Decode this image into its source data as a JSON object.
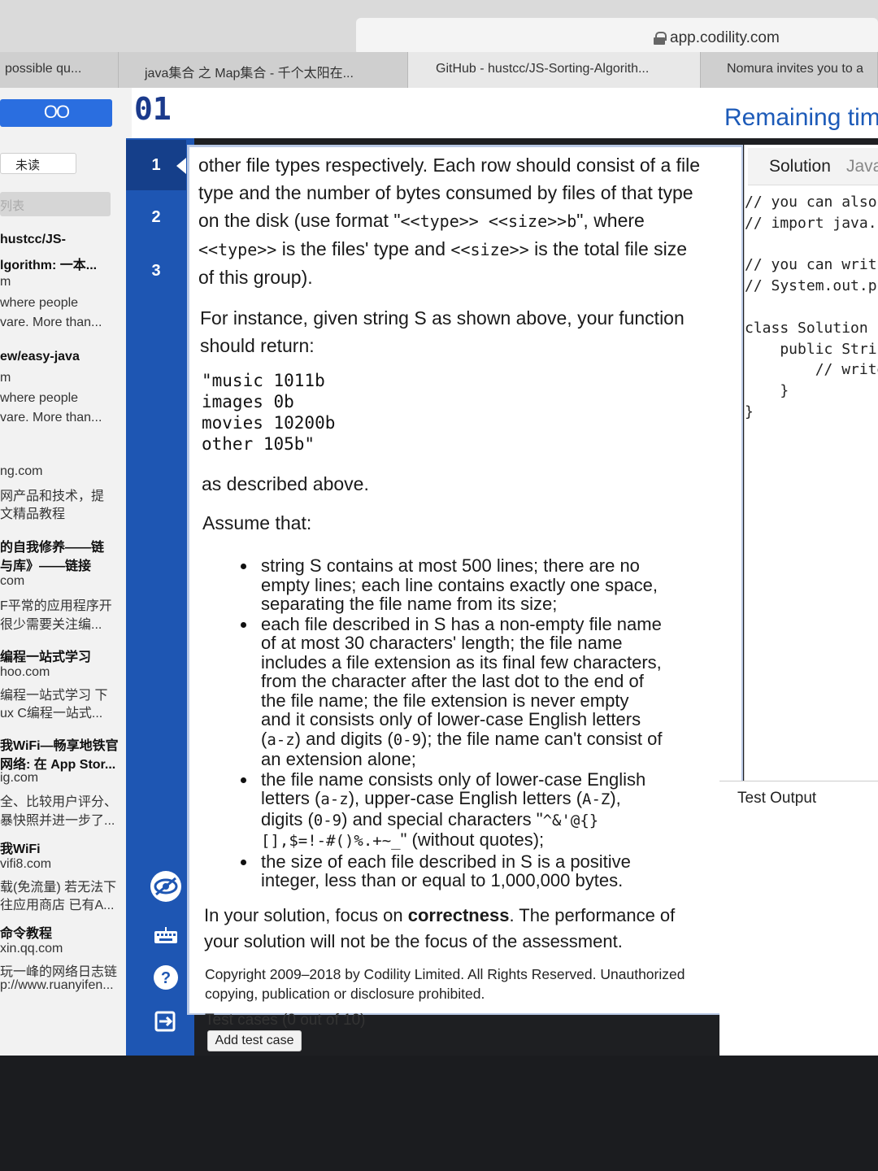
{
  "browser": {
    "url": "app.codility.com",
    "tabs": [
      {
        "label": "possible qu..."
      },
      {
        "label": "java集合 之 Map集合 - 千个太阳在..."
      },
      {
        "label": "GitHub - hustcc/JS-Sorting-Algorith..."
      },
      {
        "label": "Nomura invites you to a"
      }
    ]
  },
  "sidebar": {
    "glasses_label": "OO",
    "unread_label": "未读",
    "list_label": "列表",
    "feed_lines": [
      "hustcc/JS-",
      "lgorithm: 一本...",
      "m",
      "where people",
      "vare. More than...",
      "ew/easy-java",
      "m",
      "where people",
      "vare. More than...",
      "ng.com",
      "网产品和技术，提",
      "文精品教程",
      "的自我修养——链",
      "与库》——链接",
      "com",
      "F平常的应用程序开",
      "很少需要关注编...",
      "编程一站式学习",
      "hoo.com",
      "编程一站式学习 下",
      "ux C编程一站式...",
      "我WiFi—畅享地铁官",
      "网络: 在 App Stor...",
      "ig.com",
      "全、比较用户评分、",
      "暴快照并进一步了...",
      "我WiFi",
      "vifi8.com",
      "载(免流量) 若无法下",
      "往应用商店 已有A...",
      "命令教程",
      "xin.qq.com",
      "玩一峰的网络日志链",
      "p://www.ruanyifen..."
    ]
  },
  "header": {
    "logo": "01",
    "remaining_time": "Remaining time"
  },
  "task_nav": {
    "items": [
      "1",
      "2",
      "3"
    ]
  },
  "description": {
    "para1_a": "other file types respectively. Each row should consist of a file",
    "para1_b": "type and the number of bytes consumed by files of that type",
    "para1_c_pre": "on the disk (use format \"",
    "para1_c_code": "<<type>> <<size>>b",
    "para1_c_post": "\", where",
    "para1_d_code1": "<<type>>",
    "para1_d_mid": " is the files' type and ",
    "para1_d_code2": "<<size>>",
    "para1_d_post": " is the total file size",
    "para1_e": "of this group).",
    "para2_a": "For instance, given string S as shown above, your function",
    "para2_b": "should return:",
    "code_example": "\"music 1011b\nimages 0b\nmovies 10200b\nother 105b\"",
    "as_described": "as described above.",
    "assume": "Assume that:",
    "bullet1": "string S contains at most 500 lines; there are no empty lines; each line contains exactly one space, separating the file name from its size;",
    "bullet2_a": "each file described in S has a non-empty file name of at most 30 characters' length; the file name includes a file extension as its final few characters, from the character after the last dot to the end of the file name; the file extension is never empty and it consists only of lower-case English letters (",
    "bullet2_code1": "a-z",
    "bullet2_b": ") and digits (",
    "bullet2_code2": "0-9",
    "bullet2_c": "); the file name can't consist of an extension alone;",
    "bullet3_a": "the file name consists only of lower-case English letters (",
    "bullet3_code1": "a-z",
    "bullet3_b": "), upper-case English letters (",
    "bullet3_code2": "A-Z",
    "bullet3_c": "), digits (",
    "bullet3_code3": "0-9",
    "bullet3_d": ") and special characters \"",
    "bullet3_code4": "^&'@{}[],$=!-#()%.+~_",
    "bullet3_e": "\" (without quotes);",
    "bullet4": "the size of each file described in S is a positive integer, less than or equal to 1,000,000 bytes.",
    "focus_pre": "In your solution, focus on ",
    "focus_bold": "correctness",
    "focus_post": ". The performance of your solution will not be the focus of the assessment.",
    "copyright": "Copyright 2009–2018 by Codility Limited. All Rights Reserved. Unauthorized copying, publication or disclosure prohibited.",
    "test_cases": "Test cases (0 out of 10)",
    "add_test_case": "Add test case"
  },
  "editor": {
    "solution_tab": "Solution",
    "language": "Java",
    "code": "// you can also\n// import java.\n\n// you can writ\n// System.out.p\n\nclass Solution {\n    public Strin\n        // write\n    }\n}",
    "test_output_label": "Test Output"
  },
  "colors": {
    "accent_blue": "#1e56b3",
    "header_blue": "#1c5ab8",
    "panel_border": "#b9c9e6"
  }
}
